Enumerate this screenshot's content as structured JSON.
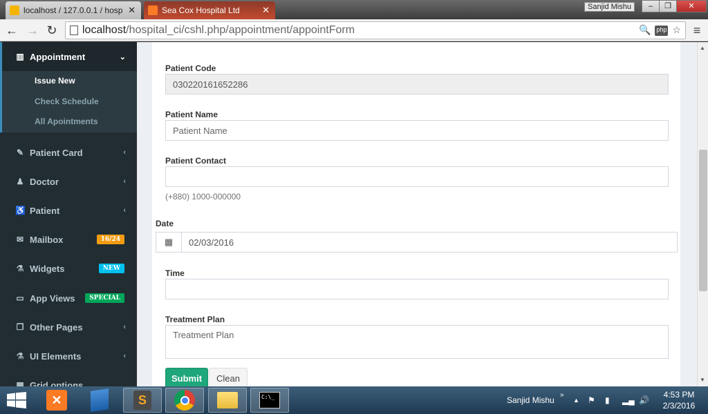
{
  "browser": {
    "tabs": [
      {
        "title": "localhost / 127.0.0.1 / hosp",
        "active": false
      },
      {
        "title": "Sea Cox Hospital Ltd",
        "active": true
      }
    ],
    "user": "Sanjid Mishu",
    "url_host": "localhost",
    "url_path": "/hospital_ci/cshl.php/appointment/appointForm"
  },
  "sidebar": {
    "appointment": {
      "label": "Appointment",
      "icon": "bar-chart-icon"
    },
    "sub_items": [
      {
        "label": "Issue New",
        "active": true
      },
      {
        "label": "Check Schedule",
        "active": false
      },
      {
        "label": "All Apointments",
        "active": false
      }
    ],
    "items": [
      {
        "label": "Patient Card",
        "icon": "edit-icon",
        "chevron": true
      },
      {
        "label": "Doctor",
        "icon": "user-md-icon",
        "chevron": true
      },
      {
        "label": "Patient",
        "icon": "wheelchair-icon",
        "chevron": true
      },
      {
        "label": "Mailbox",
        "icon": "envelope-icon",
        "badge": "16/24",
        "badge_color": "#f39c12"
      },
      {
        "label": "Widgets",
        "icon": "flask-icon",
        "badge": "NEW",
        "badge_color": "#00c0ef"
      },
      {
        "label": "App Views",
        "icon": "desktop-icon",
        "badge": "SPECIAL",
        "badge_color": "#00a65a"
      },
      {
        "label": "Other Pages",
        "icon": "files-icon",
        "chevron": true
      },
      {
        "label": "UI Elements",
        "icon": "flask-icon",
        "chevron": true
      },
      {
        "label": "Grid options",
        "icon": "grid-icon",
        "chevron": false
      }
    ]
  },
  "form": {
    "patient_code": {
      "label": "Patient Code",
      "value": "030220161652286"
    },
    "patient_name": {
      "label": "Patient Name",
      "placeholder": "Patient Name"
    },
    "patient_contact": {
      "label": "Patient Contact",
      "help": "(+880) 1000-000000"
    },
    "date": {
      "label": "Date",
      "value": "02/03/2016"
    },
    "time": {
      "label": "Time"
    },
    "treatment_plan": {
      "label": "Treatment Plan",
      "placeholder": "Treatment Plan"
    },
    "submit_label": "Submit",
    "clean_label": "Clean"
  },
  "taskbar": {
    "user": "Sanjid Mishu",
    "time": "4:53 PM",
    "date": "2/3/2016"
  }
}
